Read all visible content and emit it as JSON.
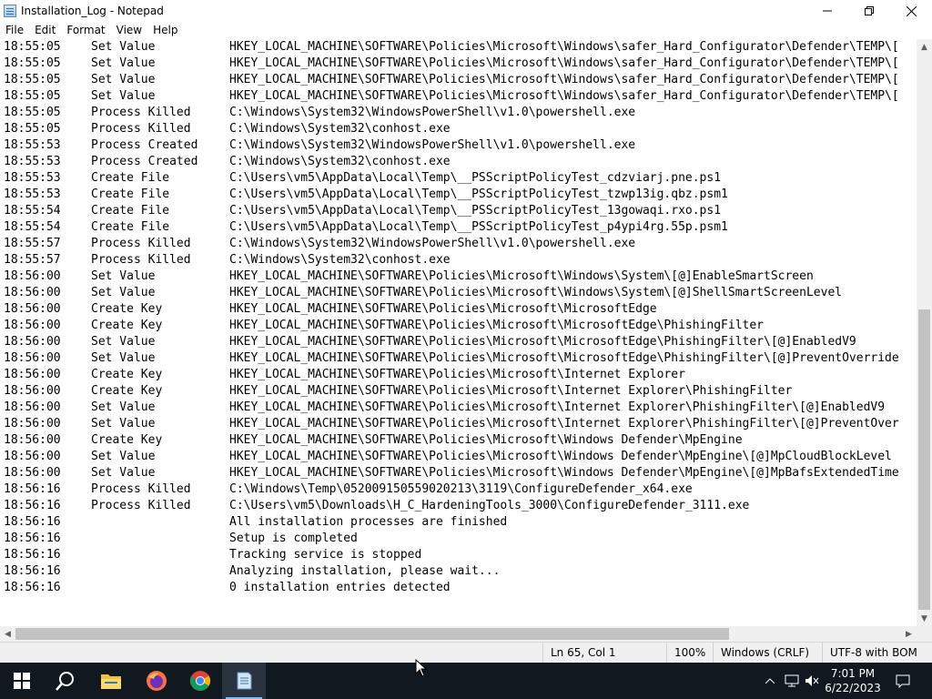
{
  "window": {
    "title": "Installation_Log - Notepad",
    "minimize_icon": "minimize-icon",
    "maximize_icon": "restore-icon",
    "close_icon": "close-icon"
  },
  "menu": [
    "File",
    "Edit",
    "Format",
    "View",
    "Help"
  ],
  "log_lines": [
    {
      "time": "18:55:05",
      "action": "Set Value",
      "path": "HKEY_LOCAL_MACHINE\\SOFTWARE\\Policies\\Microsoft\\Windows\\safer_Hard_Configurator\\Defender\\TEMP\\["
    },
    {
      "time": "18:55:05",
      "action": "Set Value",
      "path": "HKEY_LOCAL_MACHINE\\SOFTWARE\\Policies\\Microsoft\\Windows\\safer_Hard_Configurator\\Defender\\TEMP\\["
    },
    {
      "time": "18:55:05",
      "action": "Set Value",
      "path": "HKEY_LOCAL_MACHINE\\SOFTWARE\\Policies\\Microsoft\\Windows\\safer_Hard_Configurator\\Defender\\TEMP\\["
    },
    {
      "time": "18:55:05",
      "action": "Set Value",
      "path": "HKEY_LOCAL_MACHINE\\SOFTWARE\\Policies\\Microsoft\\Windows\\safer_Hard_Configurator\\Defender\\TEMP\\["
    },
    {
      "time": "18:55:05",
      "action": "Process Killed",
      "path": "C:\\Windows\\System32\\WindowsPowerShell\\v1.0\\powershell.exe"
    },
    {
      "time": "18:55:05",
      "action": "Process Killed",
      "path": "C:\\Windows\\System32\\conhost.exe"
    },
    {
      "time": "18:55:53",
      "action": "Process Created",
      "path": "C:\\Windows\\System32\\WindowsPowerShell\\v1.0\\powershell.exe"
    },
    {
      "time": "18:55:53",
      "action": "Process Created",
      "path": "C:\\Windows\\System32\\conhost.exe"
    },
    {
      "time": "18:55:53",
      "action": "Create File",
      "path": "C:\\Users\\vm5\\AppData\\Local\\Temp\\__PSScriptPolicyTest_cdzviarj.pne.ps1"
    },
    {
      "time": "18:55:53",
      "action": "Create File",
      "path": "C:\\Users\\vm5\\AppData\\Local\\Temp\\__PSScriptPolicyTest_tzwp13ig.qbz.psm1"
    },
    {
      "time": "18:55:54",
      "action": "Create File",
      "path": "C:\\Users\\vm5\\AppData\\Local\\Temp\\__PSScriptPolicyTest_13gowaqi.rxo.ps1"
    },
    {
      "time": "18:55:54",
      "action": "Create File",
      "path": "C:\\Users\\vm5\\AppData\\Local\\Temp\\__PSScriptPolicyTest_p4ypi4rg.55p.psm1"
    },
    {
      "time": "18:55:57",
      "action": "Process Killed",
      "path": "C:\\Windows\\System32\\WindowsPowerShell\\v1.0\\powershell.exe"
    },
    {
      "time": "18:55:57",
      "action": "Process Killed",
      "path": "C:\\Windows\\System32\\conhost.exe"
    },
    {
      "time": "18:56:00",
      "action": "Set Value",
      "path": "HKEY_LOCAL_MACHINE\\SOFTWARE\\Policies\\Microsoft\\Windows\\System\\[@]EnableSmartScreen"
    },
    {
      "time": "18:56:00",
      "action": "Set Value",
      "path": "HKEY_LOCAL_MACHINE\\SOFTWARE\\Policies\\Microsoft\\Windows\\System\\[@]ShellSmartScreenLevel"
    },
    {
      "time": "18:56:00",
      "action": "Create Key",
      "path": "HKEY_LOCAL_MACHINE\\SOFTWARE\\Policies\\Microsoft\\MicrosoftEdge"
    },
    {
      "time": "18:56:00",
      "action": "Create Key",
      "path": "HKEY_LOCAL_MACHINE\\SOFTWARE\\Policies\\Microsoft\\MicrosoftEdge\\PhishingFilter"
    },
    {
      "time": "18:56:00",
      "action": "Set Value",
      "path": "HKEY_LOCAL_MACHINE\\SOFTWARE\\Policies\\Microsoft\\MicrosoftEdge\\PhishingFilter\\[@]EnabledV9"
    },
    {
      "time": "18:56:00",
      "action": "Set Value",
      "path": "HKEY_LOCAL_MACHINE\\SOFTWARE\\Policies\\Microsoft\\MicrosoftEdge\\PhishingFilter\\[@]PreventOverride"
    },
    {
      "time": "18:56:00",
      "action": "Create Key",
      "path": "HKEY_LOCAL_MACHINE\\SOFTWARE\\Policies\\Microsoft\\Internet Explorer"
    },
    {
      "time": "18:56:00",
      "action": "Create Key",
      "path": "HKEY_LOCAL_MACHINE\\SOFTWARE\\Policies\\Microsoft\\Internet Explorer\\PhishingFilter"
    },
    {
      "time": "18:56:00",
      "action": "Set Value",
      "path": "HKEY_LOCAL_MACHINE\\SOFTWARE\\Policies\\Microsoft\\Internet Explorer\\PhishingFilter\\[@]EnabledV9"
    },
    {
      "time": "18:56:00",
      "action": "Set Value",
      "path": "HKEY_LOCAL_MACHINE\\SOFTWARE\\Policies\\Microsoft\\Internet Explorer\\PhishingFilter\\[@]PreventOver"
    },
    {
      "time": "18:56:00",
      "action": "Create Key",
      "path": "HKEY_LOCAL_MACHINE\\SOFTWARE\\Policies\\Microsoft\\Windows Defender\\MpEngine"
    },
    {
      "time": "18:56:00",
      "action": "Set Value",
      "path": "HKEY_LOCAL_MACHINE\\SOFTWARE\\Policies\\Microsoft\\Windows Defender\\MpEngine\\[@]MpCloudBlockLevel"
    },
    {
      "time": "18:56:00",
      "action": "Set Value",
      "path": "HKEY_LOCAL_MACHINE\\SOFTWARE\\Policies\\Microsoft\\Windows Defender\\MpEngine\\[@]MpBafsExtendedTime"
    },
    {
      "time": "18:56:16",
      "action": "Process Killed",
      "path": "C:\\Windows\\Temp\\052009150559020213\\3119\\ConfigureDefender_x64.exe"
    },
    {
      "time": "18:56:16",
      "action": "Process Killed",
      "path": "C:\\Users\\vm5\\Downloads\\H_C_HardeningTools_3000\\ConfigureDefender_3111.exe"
    },
    {
      "time": "18:56:16",
      "action": "",
      "path": "All installation processes are finished"
    },
    {
      "time": "18:56:16",
      "action": "",
      "path": "Setup is completed"
    },
    {
      "time": "18:56:16",
      "action": "",
      "path": "Tracking service is stopped"
    },
    {
      "time": "18:56:16",
      "action": "",
      "path": "Analyzing installation, please wait..."
    },
    {
      "time": "18:56:16",
      "action": "",
      "path": "0 installation entries detected"
    }
  ],
  "status": {
    "position": "Ln 65, Col 1",
    "zoom": "100%",
    "line_ending": "Windows (CRLF)",
    "encoding": "UTF-8 with BOM"
  },
  "taskbar": {
    "items": [
      "start-icon",
      "search-icon",
      "file-explorer-icon",
      "firefox-icon",
      "chrome-icon",
      "notepad-icon"
    ],
    "time": "7:01 PM",
    "date": "6/22/2023"
  },
  "colors": {
    "taskbar_bg": "#101820",
    "accent": "#0078d7",
    "scrollbar_thumb": "#c2c2c2"
  }
}
